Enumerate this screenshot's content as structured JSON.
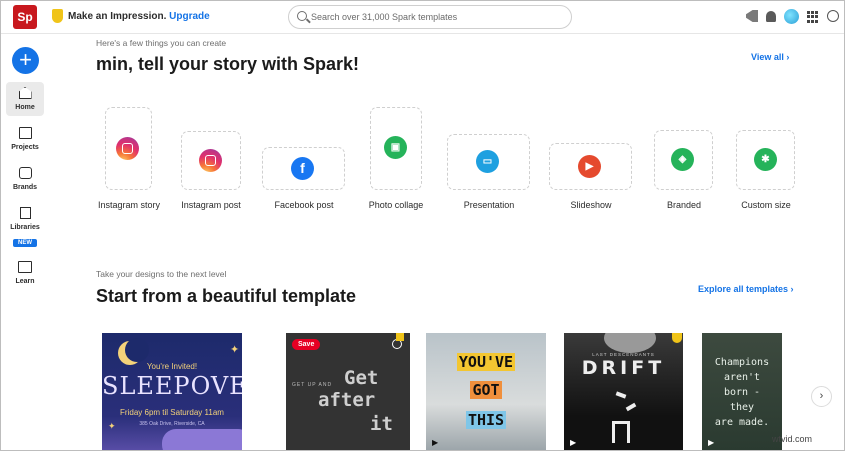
{
  "topbar": {
    "logo_text": "Sp",
    "promo_text": "Make an Impression.",
    "upgrade_label": "Upgrade",
    "search_placeholder": "Search over 31,000 Spark templates"
  },
  "rail": {
    "create_label": "+",
    "items": [
      {
        "label": "Home"
      },
      {
        "label": "Projects"
      },
      {
        "label": "Brands"
      },
      {
        "label": "Libraries",
        "badge": "NEW"
      },
      {
        "label": "Learn"
      }
    ]
  },
  "create_section": {
    "subtitle": "Here's a few things you can create",
    "title": "min, tell your story with Spark!",
    "view_all": "View all ›",
    "tiles": [
      {
        "label": "Instagram story",
        "icon": "instagram-icon"
      },
      {
        "label": "Instagram post",
        "icon": "instagram-icon"
      },
      {
        "label": "Facebook post",
        "icon": "facebook-icon",
        "glyph": "f"
      },
      {
        "label": "Photo collage",
        "icon": "collage-icon",
        "glyph": "▣"
      },
      {
        "label": "Presentation",
        "icon": "presentation-icon",
        "glyph": "▭"
      },
      {
        "label": "Slideshow",
        "icon": "slideshow-icon",
        "glyph": "▶"
      },
      {
        "label": "Branded",
        "icon": "branded-icon",
        "glyph": "◈"
      },
      {
        "label": "Custom size",
        "icon": "custom-size-icon",
        "glyph": "✱"
      }
    ]
  },
  "templates_section": {
    "subtitle": "Take your designs to the next level",
    "title": "Start from a beautiful template",
    "explore_all": "Explore all templates ›",
    "cards": [
      {
        "name": "sleepover",
        "invited": "You're Invited!",
        "headline": "SLEEPOVER",
        "when": "Friday 6pm til Saturday 11am",
        "address": "385 Oak Drive, Riverside, CA"
      },
      {
        "name": "get-up-and-get-after-it",
        "save_label": "Save",
        "small_text": "GET UP AND",
        "big_words": [
          "Get",
          "after",
          "it"
        ]
      },
      {
        "name": "youve-got-this",
        "words": [
          "YOU'VE",
          "GOT",
          "THIS"
        ]
      },
      {
        "name": "drift",
        "small_text": "LAST DESCENDANTS",
        "headline": "DRIFT"
      },
      {
        "name": "champions",
        "lines": [
          "Champions",
          "aren't",
          "born -",
          "they",
          "are made."
        ]
      }
    ],
    "next_label": "›"
  },
  "watermark": "wtvid.com",
  "colors": {
    "accent": "#1473e6",
    "logo_red": "#c8181e"
  }
}
